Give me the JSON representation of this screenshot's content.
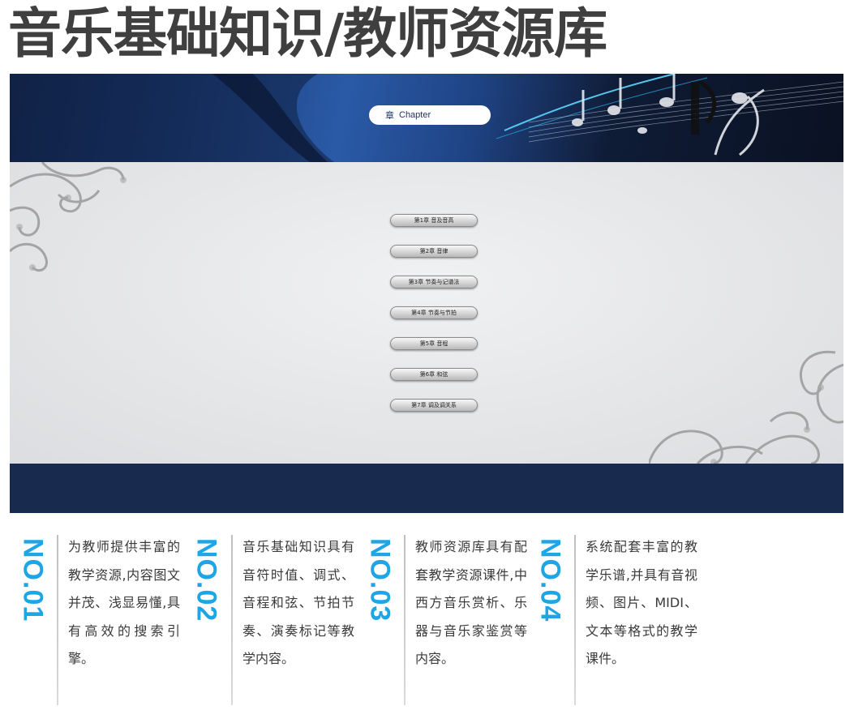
{
  "page": {
    "title": "音乐基础知识/教师资源库"
  },
  "banner": {
    "chapter_pill": {
      "glyph": "章",
      "label": "Chapter"
    }
  },
  "chapter_menu": {
    "items": [
      {
        "label": "第1章 音及音高"
      },
      {
        "label": "第2章 音律"
      },
      {
        "label": "第3章 节奏与记谱法"
      },
      {
        "label": "第4章 节奏与节拍"
      },
      {
        "label": "第5章 音程"
      },
      {
        "label": "第6章 和弦"
      },
      {
        "label": "第7章 调及调关系"
      }
    ]
  },
  "features": [
    {
      "number": "NO.01",
      "text": "为教师提供丰富的教学资源,内容图文并茂、浅显易懂,具有高效的搜索引擎。"
    },
    {
      "number": "NO.02",
      "text": "音乐基础知识具有音符时值、调式、音程和弦、节拍节奏、演奏标记等教学内容。"
    },
    {
      "number": "NO.03",
      "text": "教师资源库具有配套教学资源课件,中西方音乐赏析、乐器与音乐家鉴赏等内容。"
    },
    {
      "number": "NO.04",
      "text": "系统配套丰富的教学乐谱,并具有音视频、图片、MIDI、文本等格式的教学课件。"
    }
  ],
  "colors": {
    "accent_number": "#1ea5e6",
    "footer_band": "#182b4f",
    "title_text": "#3f3f3f"
  }
}
